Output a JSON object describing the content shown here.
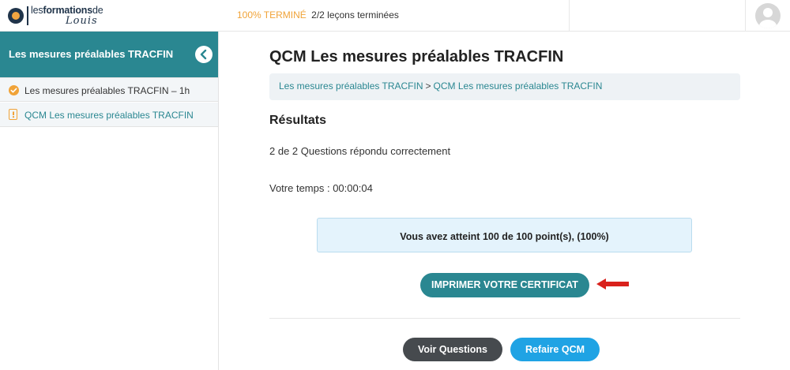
{
  "header": {
    "logo": {
      "text_prefix": "les",
      "text_bold": "formations",
      "text_suffix": "de",
      "script": "Louis"
    },
    "progress": {
      "percent_label": "100% TERMINÉ",
      "count_label": "2/2 leçons terminées",
      "percent": 100
    },
    "avatar_icon": "user-avatar-icon"
  },
  "sidebar": {
    "title": "Les mesures préalables TRACFIN",
    "toggle_icon": "chevron-left-icon",
    "items": [
      {
        "label": "Les mesures préalables TRACFIN – 1h",
        "icon": "check-circle-icon",
        "status": "completed"
      },
      {
        "label": "QCM Les mesures préalables TRACFIN",
        "icon": "quiz-icon",
        "status": "current"
      }
    ]
  },
  "main": {
    "title": "QCM Les mesures préalables TRACFIN",
    "breadcrumb": {
      "items": [
        "Les mesures préalables TRACFIN",
        "QCM Les mesures préalables TRACFIN"
      ],
      "separator": ">"
    },
    "results_heading": "Résultats",
    "answered": "2 de 2 Questions répondu correctement",
    "time": "Votre temps : 00:00:04",
    "score": "Vous avez atteint 100 de 100 point(s), (100%)",
    "certificate_button": "IMPRIMER VOTRE CERTIFICAT",
    "view_questions_button": "Voir Questions",
    "retry_button": "Refaire QCM"
  },
  "colors": {
    "teal": "#2a8791",
    "orange": "#f0a338",
    "light_blue": "#e4f3fc",
    "retry_blue": "#1fa3e4",
    "dark_button": "#464a4e",
    "arrow_red": "#d9211c"
  }
}
